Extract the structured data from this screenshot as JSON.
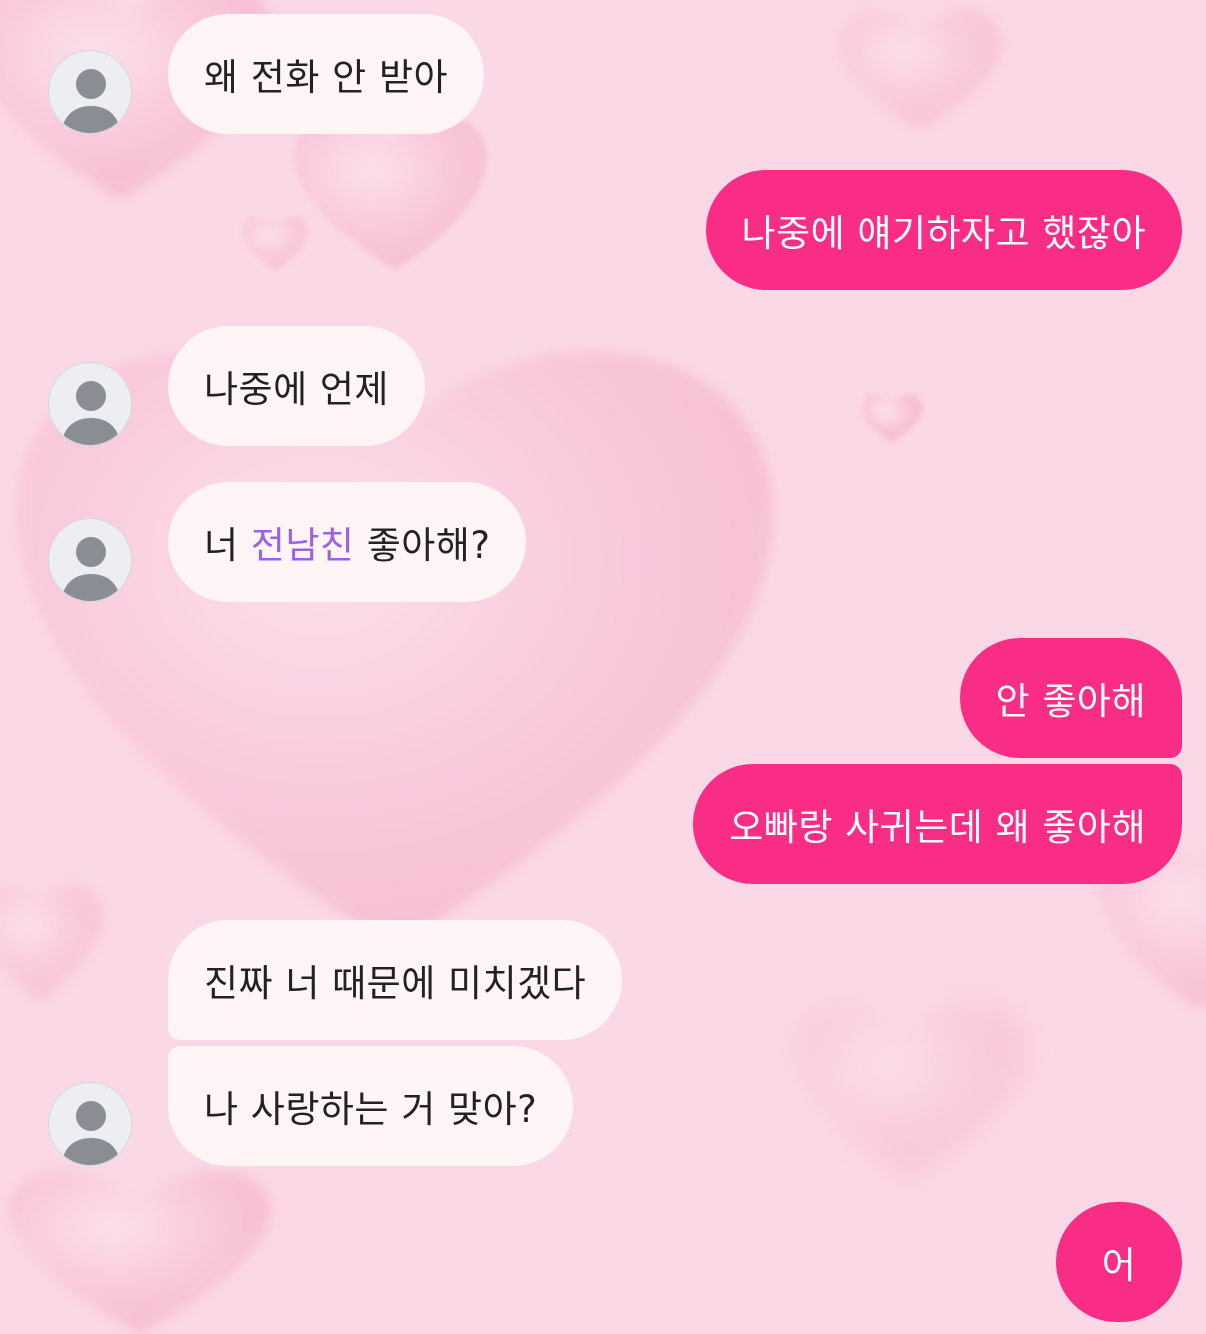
{
  "colors": {
    "background": "#fbd7e6",
    "received_bubble": "#fff4f6",
    "sent_bubble": "#fa2d86",
    "highlight_text": "#9a61e0"
  },
  "messages": [
    {
      "id": "m1",
      "side": "received",
      "text": "왜 전화 안 받아"
    },
    {
      "id": "m2",
      "side": "sent",
      "text": "나중에 얘기하자고 했잖아"
    },
    {
      "id": "m3",
      "side": "received",
      "text": "나중에 언제"
    },
    {
      "id": "m4",
      "side": "received",
      "pre": "너 ",
      "highlight": "전남친",
      "post": " 좋아해?"
    },
    {
      "id": "m5",
      "side": "sent",
      "text": "안 좋아해"
    },
    {
      "id": "m6",
      "side": "sent",
      "text": "오빠랑 사귀는데 왜 좋아해"
    },
    {
      "id": "m7",
      "side": "received",
      "text": "진짜 너 때문에 미치겠다"
    },
    {
      "id": "m8",
      "side": "received",
      "text": "나 사랑하는 거 맞아?"
    },
    {
      "id": "m9",
      "side": "sent",
      "text": "어"
    }
  ],
  "avatar_icon": "person-icon"
}
